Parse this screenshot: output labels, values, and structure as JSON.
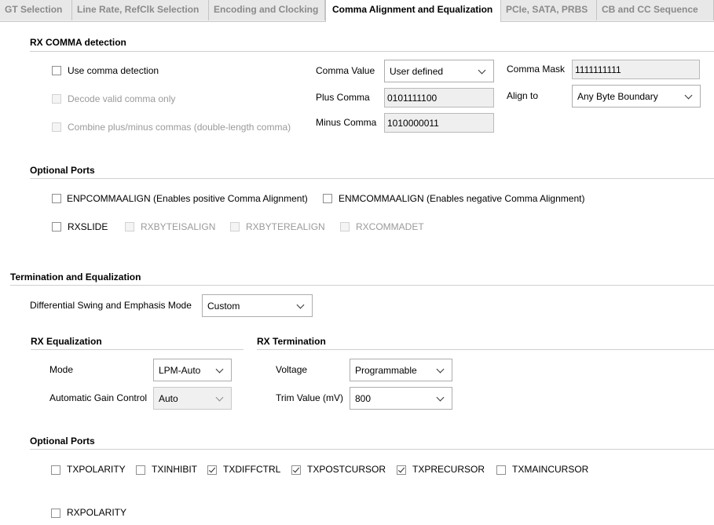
{
  "tabs": [
    {
      "label": "GT Selection"
    },
    {
      "label": "Line Rate, RefClk Selection"
    },
    {
      "label": "Encoding and Clocking"
    },
    {
      "label": "Comma Alignment and Equalization"
    },
    {
      "label": "PCIe, SATA, PRBS"
    },
    {
      "label": "CB and CC Sequence"
    }
  ],
  "comma": {
    "title": "RX COMMA detection",
    "use_comma_detection": "Use comma detection",
    "decode_valid_comma_only": "Decode valid comma only",
    "combine_commas": "Combine plus/minus commas (double-length comma)",
    "comma_value_label": "Comma Value",
    "comma_value": "User defined",
    "plus_comma_label": "Plus Comma",
    "plus_comma": "0101111100",
    "minus_comma_label": "Minus Comma",
    "minus_comma": "1010000011",
    "comma_mask_label": "Comma Mask",
    "comma_mask": "1111111111",
    "align_to_label": "Align to",
    "align_to": "Any Byte Boundary"
  },
  "optional_ports_rx": {
    "title": "Optional Ports",
    "enpcommaalign": "ENPCOMMAALIGN (Enables positive Comma Alignment)",
    "enmcommaalign": "ENMCOMMAALIGN (Enables negative Comma Alignment)",
    "rxslide": "RXSLIDE",
    "rxbyteisaligned": "RXBYTEISALIGN",
    "rxbyterealign": "RXBYTEREALIGN",
    "rxcommadet": "RXCOMMADET"
  },
  "termination": {
    "title": "Termination and Equalization",
    "diff_swing_label": "Differential Swing and Emphasis Mode",
    "diff_swing_value": "Custom"
  },
  "rx_eq": {
    "title": "RX Equalization",
    "mode_label": "Mode",
    "mode_value": "LPM-Auto",
    "agc_label": "Automatic Gain Control",
    "agc_value": "Auto"
  },
  "rx_term": {
    "title": "RX Termination",
    "voltage_label": "Voltage",
    "voltage_value": "Programmable",
    "trim_label": "Trim Value (mV)",
    "trim_value": "800"
  },
  "optional_ports_tx": {
    "title": "Optional Ports",
    "items": [
      {
        "label": "TXPOLARITY",
        "checked": false
      },
      {
        "label": "TXINHIBIT",
        "checked": false
      },
      {
        "label": "TXDIFFCTRL",
        "checked": true
      },
      {
        "label": "TXPOSTCURSOR",
        "checked": true
      },
      {
        "label": "TXPRECURSOR",
        "checked": true
      },
      {
        "label": "TXMAINCURSOR",
        "checked": false
      }
    ],
    "rxpolarity": "RXPOLARITY"
  }
}
